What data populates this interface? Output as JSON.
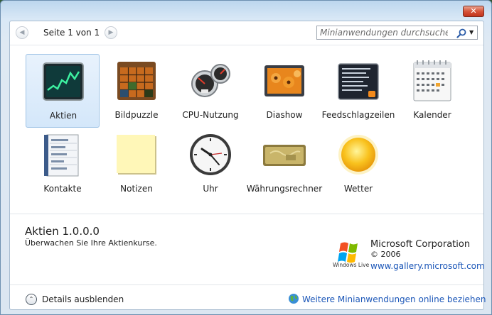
{
  "window": {
    "close_glyph": "✕"
  },
  "pager": {
    "prev_icon": "◀",
    "next_icon": "▶",
    "text": "Seite 1 von 1"
  },
  "search": {
    "placeholder": "Minianwendungen durchsuchen",
    "dropdown_icon": "▼"
  },
  "gadgets": [
    {
      "label": "Aktien",
      "icon": "stocks-icon",
      "selected": true
    },
    {
      "label": "Bildpuzzle",
      "icon": "picture-puzzle-icon"
    },
    {
      "label": "CPU-Nutzung",
      "icon": "cpu-meter-icon"
    },
    {
      "label": "Diashow",
      "icon": "slideshow-icon"
    },
    {
      "label": "Feedschlagzeilen",
      "icon": "feed-headlines-icon"
    },
    {
      "label": "Kalender",
      "icon": "calendar-icon"
    },
    {
      "label": "Kontakte",
      "icon": "contacts-icon"
    },
    {
      "label": "Notizen",
      "icon": "notes-icon"
    },
    {
      "label": "Uhr",
      "icon": "clock-icon"
    },
    {
      "label": "Währungsrechner",
      "icon": "currency-icon"
    },
    {
      "label": "Wetter",
      "icon": "weather-icon"
    }
  ],
  "details": {
    "title": "Aktien 1.0.0.0",
    "description": "Überwachen Sie Ihre Aktienkurse.",
    "publisher": "Microsoft Corporation",
    "copyright": "© 2006",
    "url": "www.gallery.microsoft.com",
    "logo_text": "Windows Live"
  },
  "footer": {
    "toggle_icon": "⌃",
    "toggle_label": "Details ausblenden",
    "online_label": "Weitere Minianwendungen online beziehen"
  },
  "colors": {
    "link": "#1c57b8",
    "selection": "#d4e7fa"
  }
}
